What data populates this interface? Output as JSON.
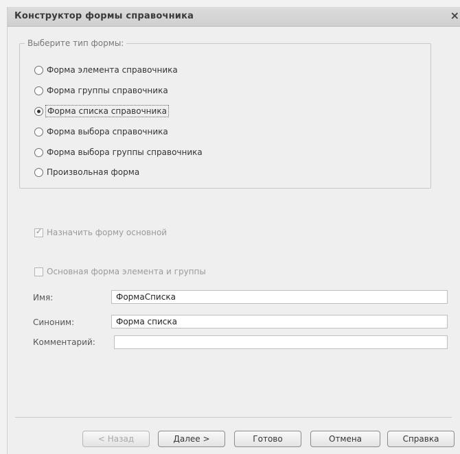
{
  "window": {
    "title": "Конструктор формы справочника",
    "close_glyph": "×"
  },
  "form_type": {
    "legend": "Выберите тип формы:",
    "options": [
      {
        "label": "Форма элемента справочника",
        "checked": false
      },
      {
        "label": "Форма группы справочника",
        "checked": false
      },
      {
        "label": "Форма списка справочника",
        "checked": true
      },
      {
        "label": "Форма выбора справочника",
        "checked": false
      },
      {
        "label": "Форма выбора группы справочника",
        "checked": false
      },
      {
        "label": "Произвольная форма",
        "checked": false
      }
    ]
  },
  "checkboxes": {
    "assign_main": {
      "label": "Назначить форму основной",
      "checked": true,
      "enabled": false
    },
    "main_element_group": {
      "label": "Основная форма элемента и группы",
      "checked": false,
      "enabled": false
    }
  },
  "fields": {
    "name": {
      "label": "Имя:",
      "value": "ФормаСписка"
    },
    "synonym": {
      "label": "Синоним:",
      "value": "Форма списка"
    },
    "comment": {
      "label": "Комментарий:",
      "value": ""
    }
  },
  "buttons": {
    "back": "< Назад",
    "next": "Далее >",
    "finish": "Готово",
    "cancel": "Отмена",
    "help": "Справка"
  }
}
